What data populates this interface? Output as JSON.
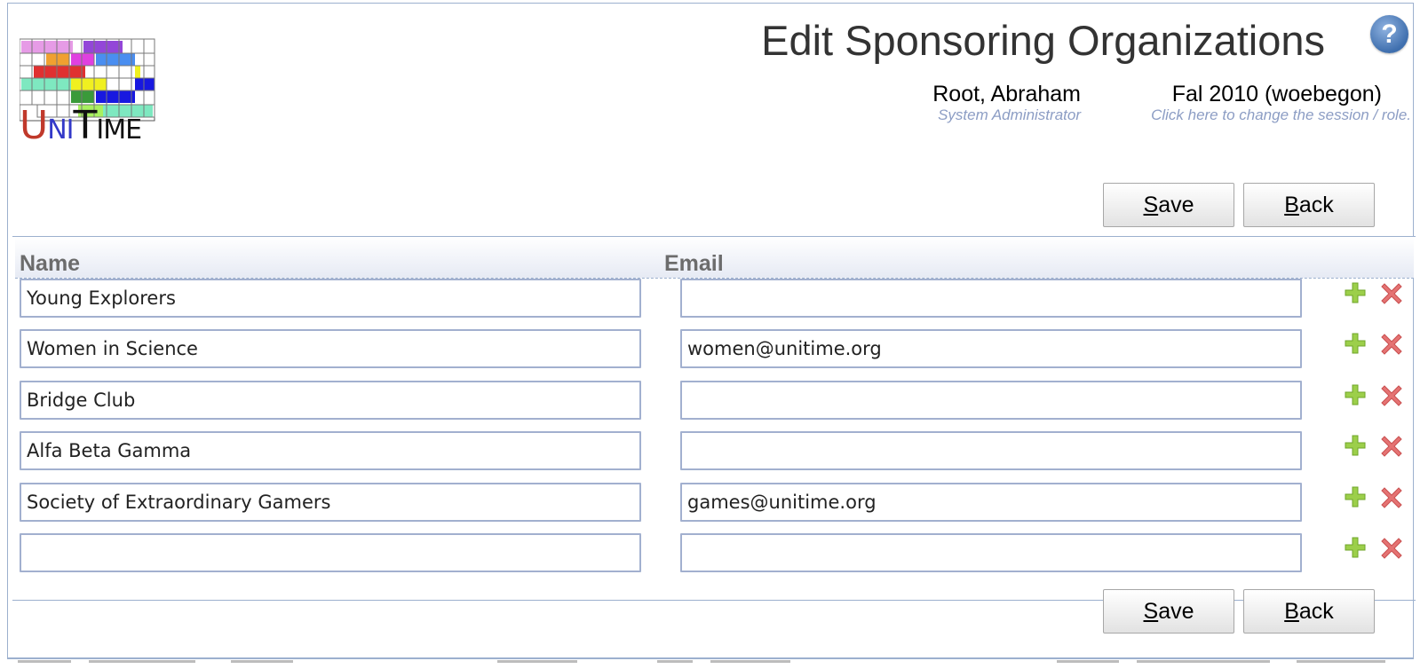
{
  "header": {
    "title": "Edit Sponsoring Organizations",
    "help_glyph": "?",
    "user": {
      "name": "Root, Abraham",
      "role": "System Administrator"
    },
    "session": {
      "name": "Fal 2010 (woebegon)",
      "hint": "Click here to change the session / role."
    }
  },
  "logo": {
    "letters": [
      "U",
      "NI",
      "T",
      "IME"
    ]
  },
  "buttons": {
    "save": {
      "accesskey": "S",
      "rest": "ave"
    },
    "back": {
      "accesskey": "B",
      "rest": "ack"
    }
  },
  "table": {
    "columns": {
      "name": "Name",
      "email": "Email"
    },
    "rows": [
      {
        "name": "Young Explorers",
        "email": ""
      },
      {
        "name": "Women in Science",
        "email": "women@unitime.org"
      },
      {
        "name": "Bridge Club",
        "email": ""
      },
      {
        "name": "Alfa Beta Gamma",
        "email": ""
      },
      {
        "name": "Society of Extraordinary Gamers",
        "email": "games@unitime.org"
      },
      {
        "name": "",
        "email": ""
      }
    ]
  },
  "icons": {
    "add": "plus-icon",
    "delete": "cross-icon",
    "help": "question-icon"
  },
  "colors": {
    "border": "#9cb0ce",
    "hint": "#8c9dc4",
    "add_icon": "#9ccf4a",
    "delete_icon": "#e57373"
  }
}
